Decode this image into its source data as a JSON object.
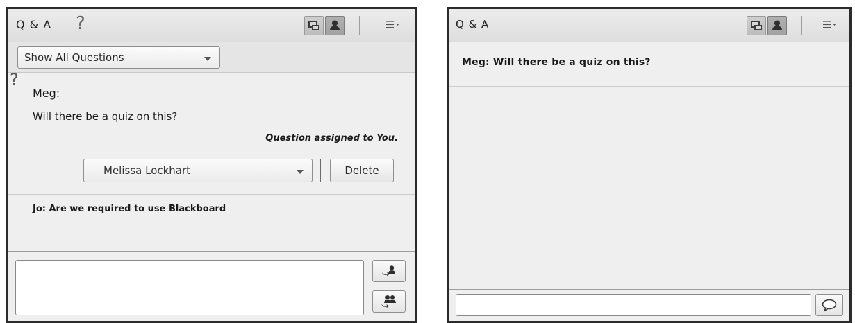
{
  "left_pod": {
    "title": "Q & A",
    "help_glyph": "?",
    "filter": {
      "selected": "Show All Questions"
    },
    "active_question": {
      "mark": "?",
      "author": "Meg:",
      "text": "Will there be a quiz on this?",
      "assigned": "Question assigned to You.",
      "assignee": "Melissa  Lockhart",
      "delete_label": "Delete"
    },
    "questions": [
      {
        "text": "Jo: Are we required to use Blackboard"
      }
    ],
    "composer": {
      "value": "",
      "placeholder": ""
    },
    "icons": [
      "presenter-view-icon",
      "participant-view-icon",
      "menu-icon",
      "send-to-presenter-icon",
      "send-to-all-icon"
    ]
  },
  "right_pod": {
    "title": "Q & A",
    "questions": [
      {
        "text": "Meg: Will there be a quiz on this?"
      }
    ],
    "composer": {
      "value": "",
      "placeholder": ""
    },
    "icons": [
      "presenter-view-icon",
      "participant-view-icon",
      "menu-icon",
      "speech-bubble-icon"
    ]
  },
  "colors": {
    "pod_border": "#2b2b2b",
    "pod_background": "#efefef",
    "active_toolbar_button": "#a8a8a8"
  }
}
